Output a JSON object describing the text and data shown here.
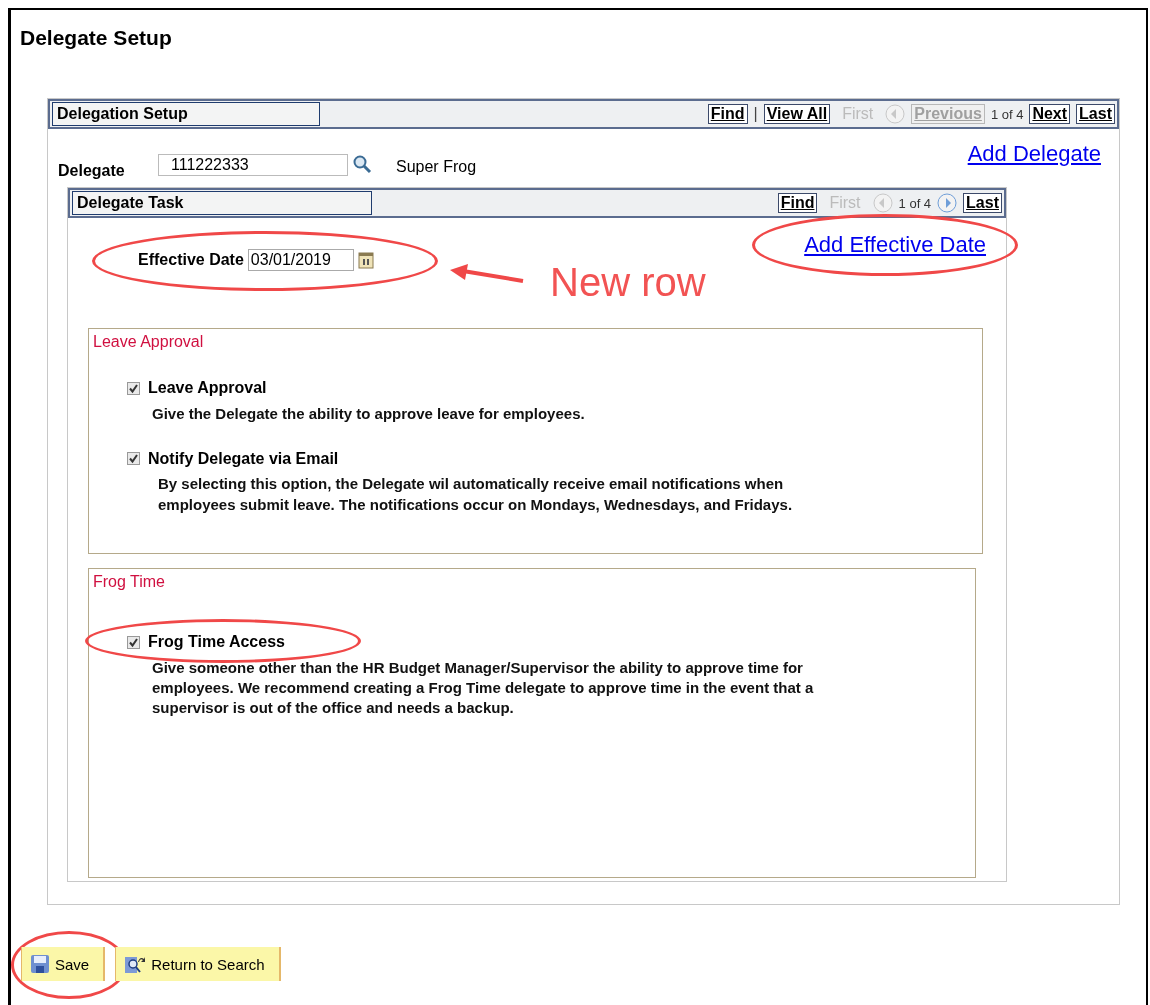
{
  "page_title": "Delegate Setup",
  "delegation": {
    "title": "Delegation Setup",
    "nav": [
      {
        "kind": "button",
        "label": "Find",
        "disabled": false
      },
      {
        "kind": "separator",
        "label": "|"
      },
      {
        "kind": "button",
        "label": "View All",
        "disabled": false
      },
      {
        "kind": "text",
        "label": "First",
        "disabled": true
      },
      {
        "kind": "prev",
        "disabled": true
      },
      {
        "kind": "button",
        "label": "Previous",
        "disabled": true
      },
      {
        "kind": "count",
        "label": "1 of 4"
      },
      {
        "kind": "button",
        "label": "Next",
        "disabled": false
      },
      {
        "kind": "button",
        "label": "Last",
        "disabled": false
      }
    ],
    "add_link": "Add Delegate",
    "delegate_label": "Delegate",
    "delegate_value": "111222333",
    "delegate_name": "Super Frog"
  },
  "task": {
    "title": "Delegate Task",
    "nav": [
      {
        "kind": "button",
        "label": "Find",
        "disabled": false
      },
      {
        "kind": "text",
        "label": "First",
        "disabled": true
      },
      {
        "kind": "prev",
        "disabled": true
      },
      {
        "kind": "count",
        "label": "1 of 4"
      },
      {
        "kind": "next",
        "disabled": false
      },
      {
        "kind": "button",
        "label": "Last",
        "disabled": false
      }
    ],
    "effective_date_label": "Effective Date",
    "effective_date": "03/01/2019",
    "date_circled": true,
    "add_link": "Add Effective Date",
    "add_link_circled": true
  },
  "groups": [
    {
      "title": "Leave Approval",
      "options": [
        {
          "label": "Leave Approval",
          "checked": true,
          "circled": false,
          "description": "Give the Delegate the ability to approve leave for employees."
        },
        {
          "label": "Notify Delegate via Email",
          "checked": true,
          "circled": false,
          "description": "By selecting this option, the Delegate wil automatically receive email notifications when employees submit leave. The notifications occur on Mondays, Wednesdays, and Fridays."
        }
      ]
    },
    {
      "title": "Frog Time",
      "options": [
        {
          "label": "Frog Time Access",
          "checked": true,
          "circled": true,
          "description": "Give someone other than the HR Budget Manager/Supervisor the ability to approve time for employees. We recommend creating a Frog Time delegate to approve time in the event that a supervisor is out of the office and needs a backup."
        }
      ]
    }
  ],
  "buttons": [
    {
      "kind": "save",
      "label": "Save",
      "circled": true
    },
    {
      "kind": "return",
      "label": "Return to Search",
      "circled": false
    }
  ],
  "annotation": {
    "text": "New row"
  }
}
